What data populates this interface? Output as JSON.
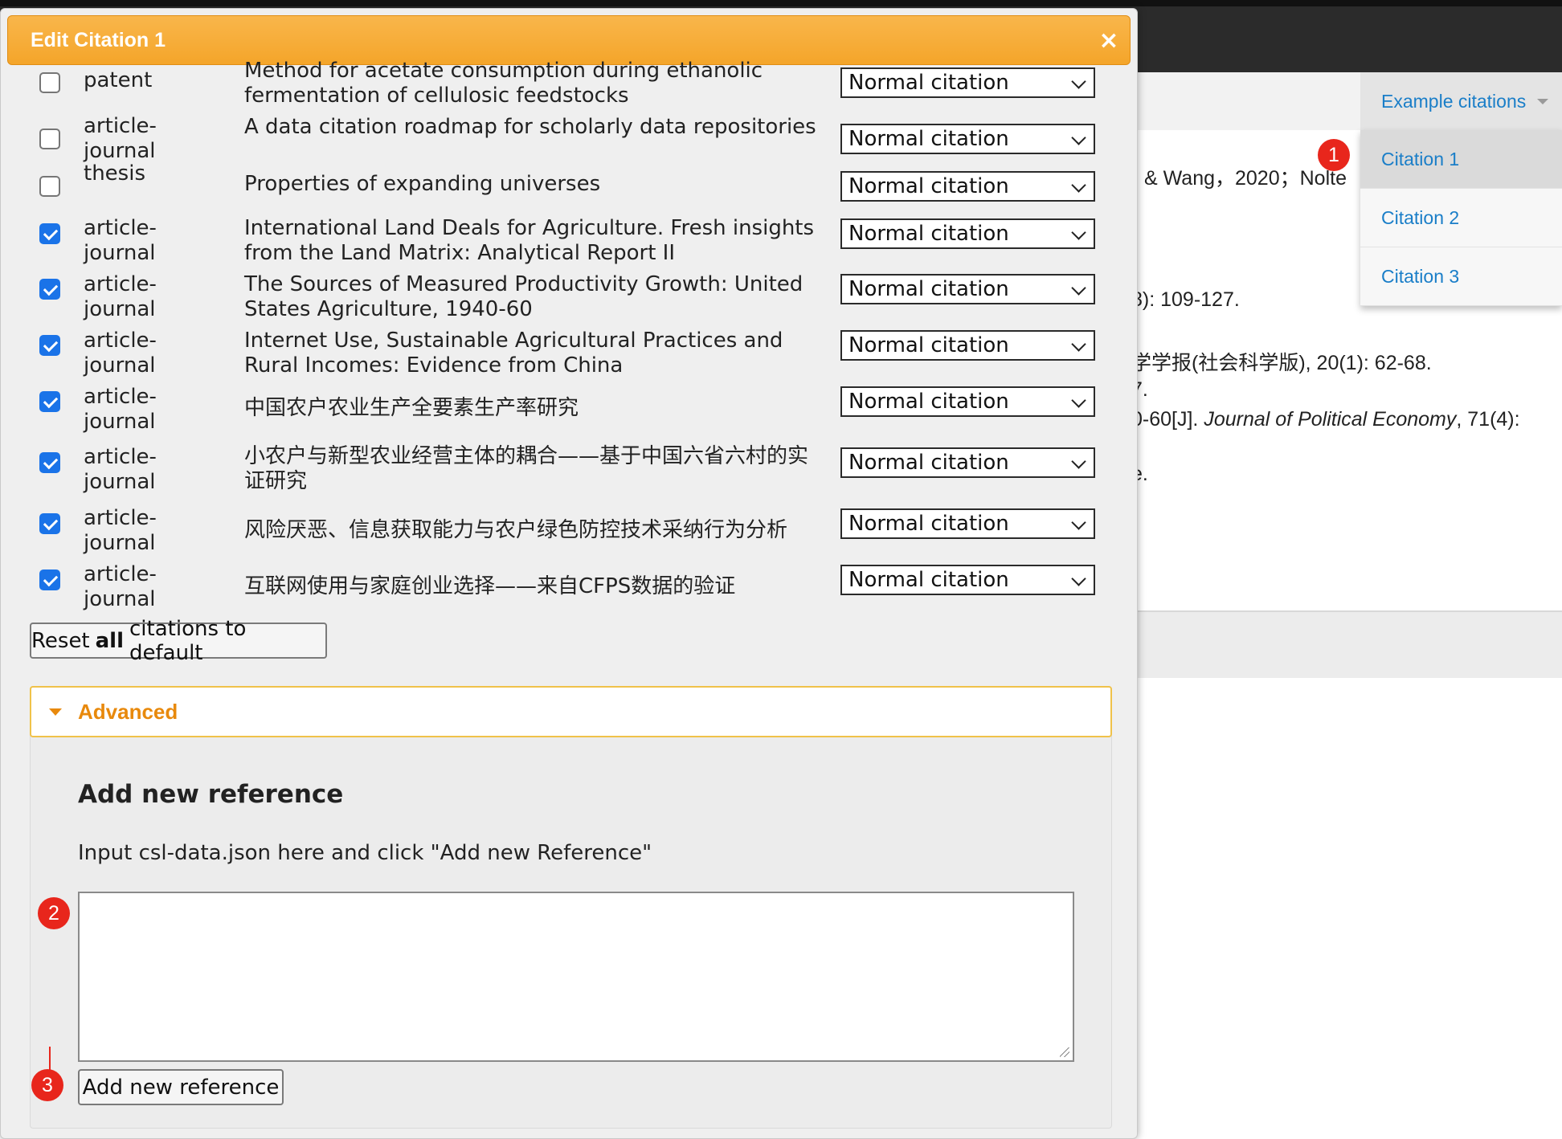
{
  "background": {
    "dropdown": {
      "label": "Example citations",
      "items": [
        {
          "label": "Citation 1",
          "active": true
        },
        {
          "label": "Citation 2",
          "active": false
        },
        {
          "label": "Citation 3",
          "active": false
        }
      ]
    },
    "text_lines": [
      "& Wang，2020；Nolte",
      "8): 109-127.",
      "学学报(社会科学版), 20(1): 62-68.",
      "7.",
      "e."
    ],
    "journal_line": {
      "prefix": "0-60[J]. ",
      "journal": "Journal of Political Economy",
      "suffix": ", 71(4):"
    }
  },
  "markers": [
    "1",
    "2",
    "3"
  ],
  "dialog": {
    "title": "Edit Citation 1",
    "close_icon": "×",
    "citations": [
      {
        "checked": false,
        "type": "patent",
        "title": "Method for acetate consumption during ethanolic fermentation of cellulosic feedstocks",
        "mode": "Normal citation"
      },
      {
        "checked": false,
        "type": "article-journal",
        "title": "A data citation roadmap for scholarly data repositories",
        "mode": "Normal citation"
      },
      {
        "checked": false,
        "type": "thesis",
        "title": "Properties of expanding universes",
        "mode": "Normal citation"
      },
      {
        "checked": true,
        "type": "article-journal",
        "title": "International Land Deals for Agriculture. Fresh insights from the Land Matrix: Analytical Report II",
        "mode": "Normal citation"
      },
      {
        "checked": true,
        "type": "article-journal",
        "title": "The Sources of Measured Productivity Growth: United States Agriculture, 1940-60",
        "mode": "Normal citation"
      },
      {
        "checked": true,
        "type": "article-journal",
        "title": "Internet Use, Sustainable Agricultural Practices and Rural Incomes: Evidence from China",
        "mode": "Normal citation"
      },
      {
        "checked": true,
        "type": "article-journal",
        "title": "中国农户农业生产全要素生产率研究",
        "mode": "Normal citation"
      },
      {
        "checked": true,
        "type": "article-journal",
        "title": "小农户与新型农业经营主体的耦合——基于中国六省六村的实证研究",
        "mode": "Normal citation"
      },
      {
        "checked": true,
        "type": "article-journal",
        "title": "风险厌恶、信息获取能力与农户绿色防控技术采纳行为分析",
        "mode": "Normal citation"
      },
      {
        "checked": true,
        "type": "article-journal",
        "title": "互联网使用与家庭创业选择——来自CFPS数据的验证",
        "mode": "Normal citation"
      }
    ],
    "reset_button": {
      "before": "Reset",
      "bold": "all",
      "after": "citations to default"
    },
    "advanced": {
      "label": "Advanced",
      "section_title": "Add new reference",
      "description": "Input csl-data.json here and click \"Add new Reference\"",
      "input_value": "",
      "add_button": "Add new reference"
    }
  }
}
